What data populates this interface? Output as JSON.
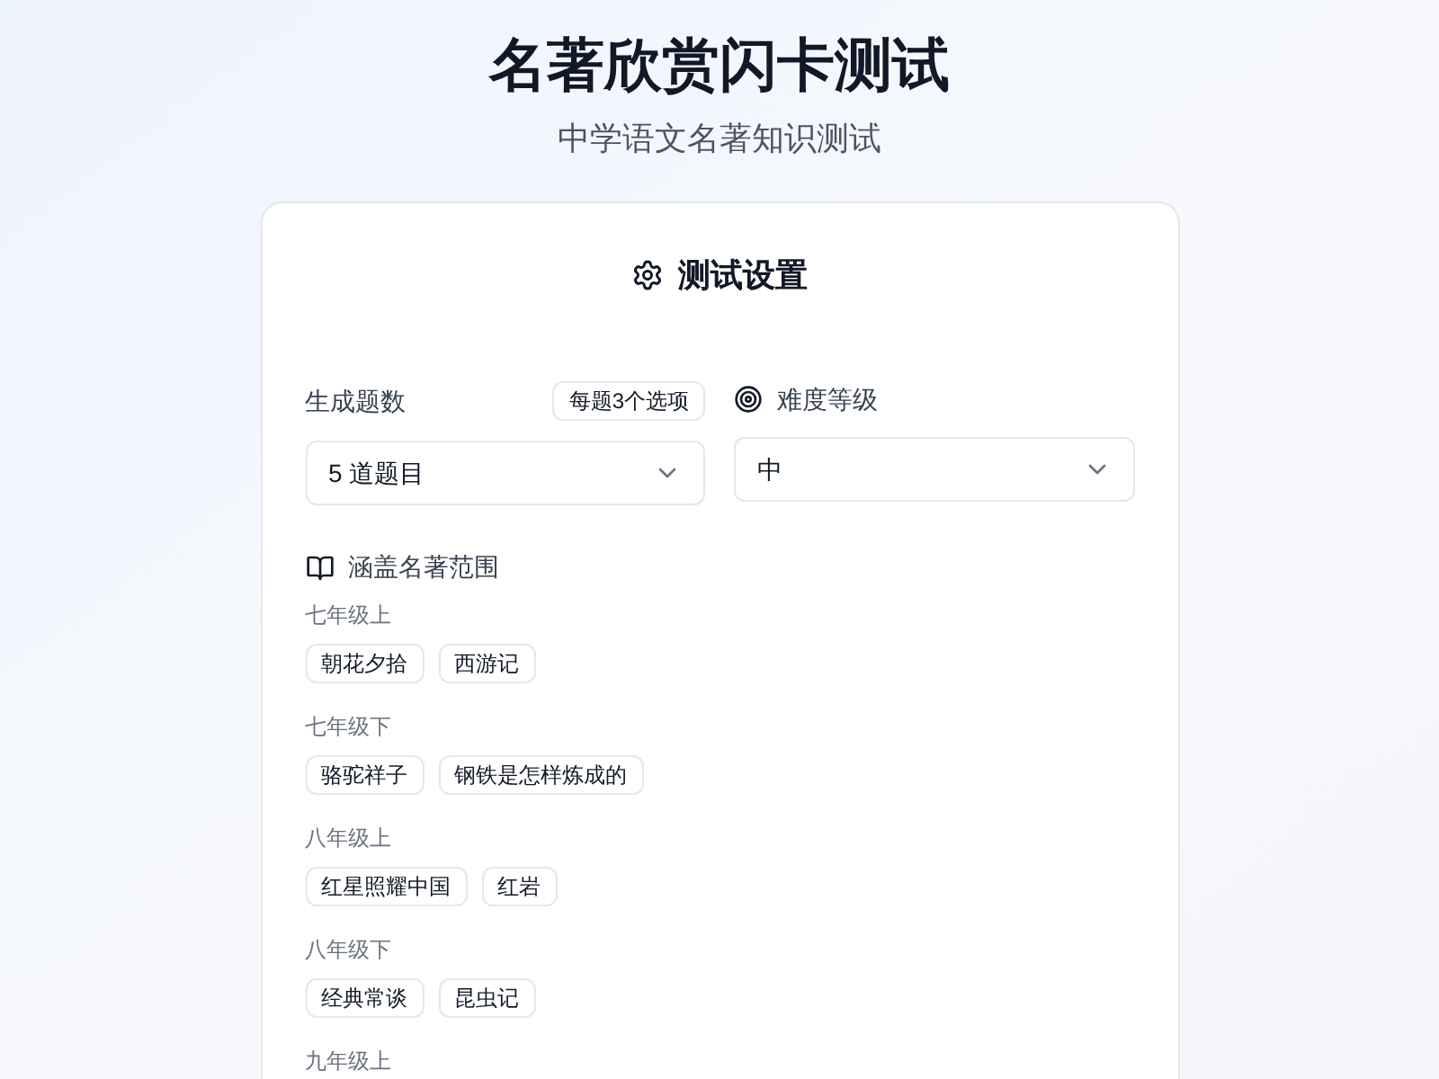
{
  "header": {
    "title": "名著欣赏闪卡测试",
    "subtitle": "中学语文名著知识测试"
  },
  "settings": {
    "title": "测试设置",
    "count": {
      "label": "生成题数",
      "badge": "每题3个选项",
      "value": "5 道题目"
    },
    "difficulty": {
      "label": "难度等级",
      "value": "中"
    },
    "scope": {
      "label": "涵盖名著范围",
      "groups": [
        {
          "grade": "七年级上",
          "books": [
            "朝花夕拾",
            "西游记"
          ]
        },
        {
          "grade": "七年级下",
          "books": [
            "骆驼祥子",
            "钢铁是怎样炼成的"
          ]
        },
        {
          "grade": "八年级上",
          "books": [
            "红星照耀中国",
            "红岩"
          ]
        },
        {
          "grade": "八年级下",
          "books": [
            "经典常谈",
            "昆虫记"
          ]
        },
        {
          "grade": "九年级上"
        }
      ]
    }
  }
}
